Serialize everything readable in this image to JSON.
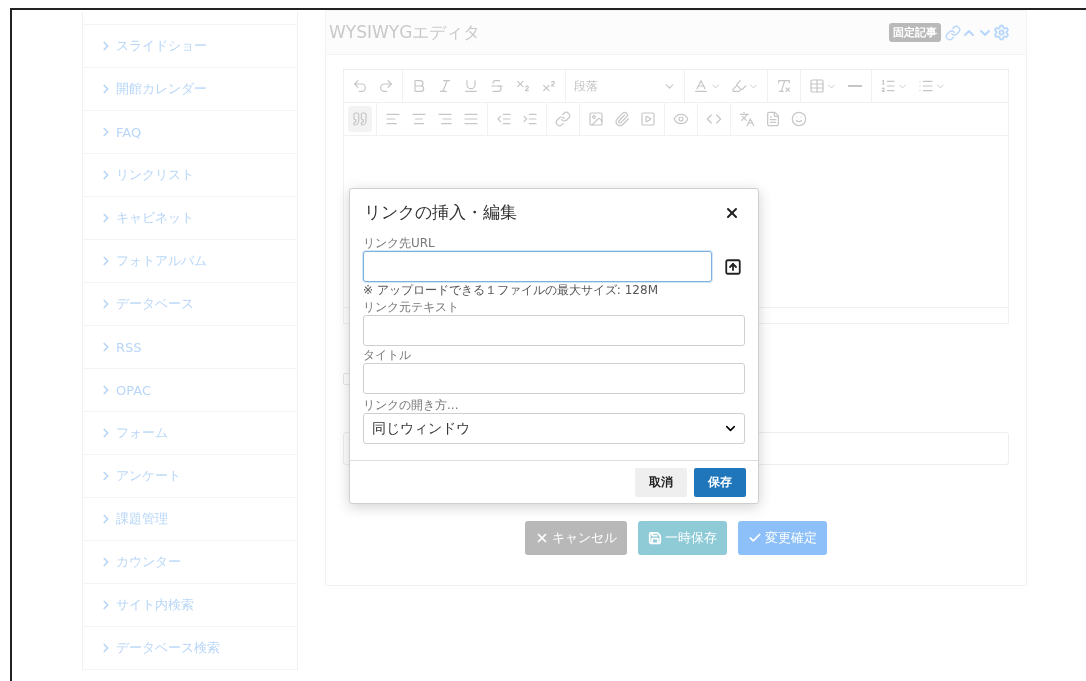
{
  "sidebar": {
    "items": [
      {
        "label": "スライドショー"
      },
      {
        "label": "開館カレンダー"
      },
      {
        "label": "FAQ"
      },
      {
        "label": "リンクリスト"
      },
      {
        "label": "キャビネット"
      },
      {
        "label": "フォトアルバム"
      },
      {
        "label": "データベース"
      },
      {
        "label": "RSS"
      },
      {
        "label": "OPAC"
      },
      {
        "label": "フォーム"
      },
      {
        "label": "アンケート"
      },
      {
        "label": "課題管理"
      },
      {
        "label": "カウンター"
      },
      {
        "label": "サイト内検索"
      },
      {
        "label": "データベース検索"
      }
    ]
  },
  "panel": {
    "title": "WYSIWYGエディタ",
    "badge": "固定記事",
    "block_format": "段落",
    "checkbox": {
      "checked": false
    },
    "buttons": [
      {
        "label": "キャンセル",
        "kind": "cancel"
      },
      {
        "label": "一時保存",
        "kind": "draft"
      },
      {
        "label": "変更確定",
        "kind": "confirm"
      }
    ]
  },
  "dialog": {
    "title": "リンクの挿入・編集",
    "fields": [
      {
        "kind": "url",
        "label": "リンク先URL",
        "focused": true,
        "note": "※ アップロードできる１ファイルの最大サイズ: 128M"
      },
      {
        "kind": "text",
        "label": "リンク元テキスト",
        "focused": false
      },
      {
        "kind": "text",
        "label": "タイトル",
        "focused": false
      },
      {
        "kind": "select",
        "label": "リンクの開き方...",
        "value": "同じウィンドウ"
      }
    ],
    "buttons": [
      {
        "label": "取消",
        "kind": "secondary"
      },
      {
        "label": "保存",
        "kind": "primary"
      }
    ]
  }
}
